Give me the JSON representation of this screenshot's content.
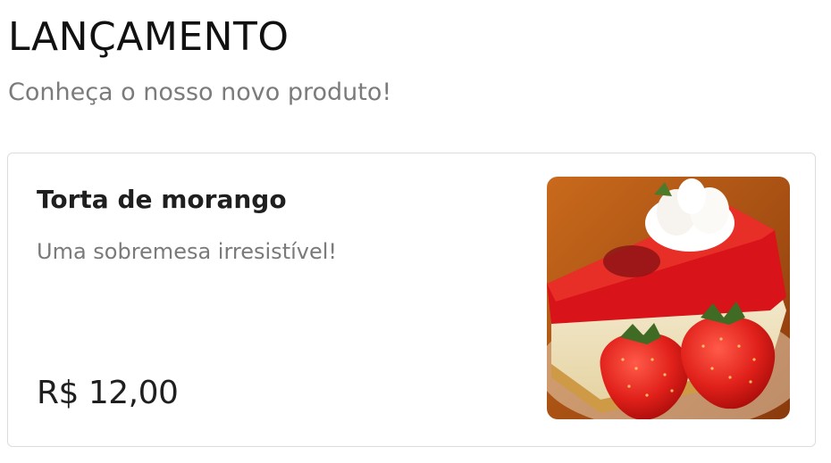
{
  "section": {
    "title": "LANÇAMENTO",
    "subtitle": "Conheça o nosso novo produto!"
  },
  "product": {
    "name": "Torta de morango",
    "description": "Uma sobremesa irresistível!",
    "price": "R$ 12,00",
    "image_icon": "strawberry-cheesecake-image"
  },
  "colors": {
    "text_primary": "#1f1f1f",
    "text_muted": "#7a7a7a",
    "card_border": "#dcdcdc"
  }
}
